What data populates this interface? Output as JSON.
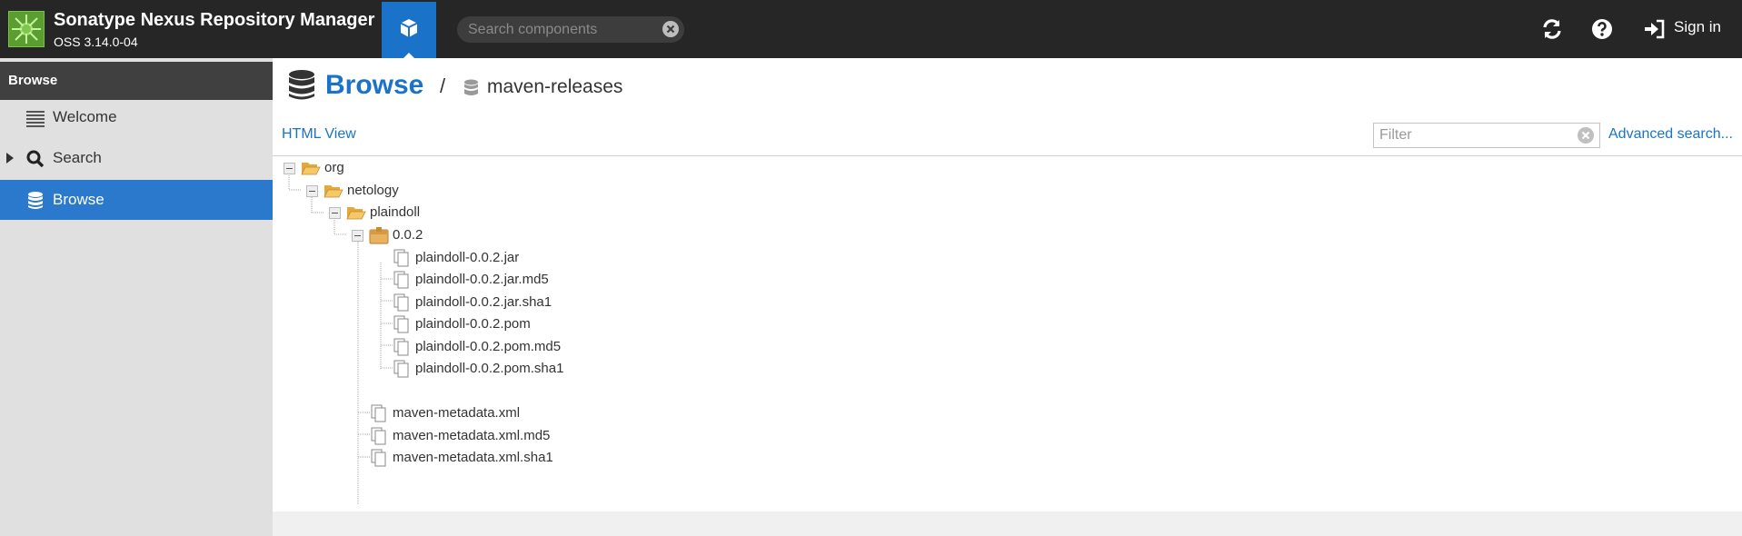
{
  "header": {
    "app_title": "Sonatype Nexus Repository Manager",
    "app_version": "OSS 3.14.0-04",
    "search_placeholder": "Search components",
    "signin_label": "Sign in",
    "icons": [
      "cube-icon",
      "refresh-icon",
      "help-icon",
      "sign-in-icon"
    ]
  },
  "sidebar": {
    "header": "Browse",
    "items": [
      {
        "label": "Welcome",
        "icon": "list-icon"
      },
      {
        "label": "Search",
        "icon": "search-icon"
      },
      {
        "label": "Browse",
        "icon": "database-icon",
        "active": true
      }
    ]
  },
  "breadcrumb": {
    "title": "Browse",
    "separator": "/",
    "repo": "maven-releases"
  },
  "toolbar": {
    "html_view": "HTML View",
    "filter_placeholder": "Filter",
    "advanced_search": "Advanced search..."
  },
  "tree": {
    "org": "org",
    "netology": "netology",
    "plaindoll": "plaindoll",
    "version": "0.0.2",
    "version_files": [
      "plaindoll-0.0.2.jar",
      "plaindoll-0.0.2.jar.md5",
      "plaindoll-0.0.2.jar.sha1",
      "plaindoll-0.0.2.pom",
      "plaindoll-0.0.2.pom.md5",
      "plaindoll-0.0.2.pom.sha1"
    ],
    "metadata_files": [
      "maven-metadata.xml",
      "maven-metadata.xml.md5",
      "maven-metadata.xml.sha1"
    ]
  },
  "colors": {
    "accent": "#1a73c9",
    "topbar": "#262626",
    "sidebar_active": "#2b79cc",
    "folder": "#f0b84a"
  }
}
